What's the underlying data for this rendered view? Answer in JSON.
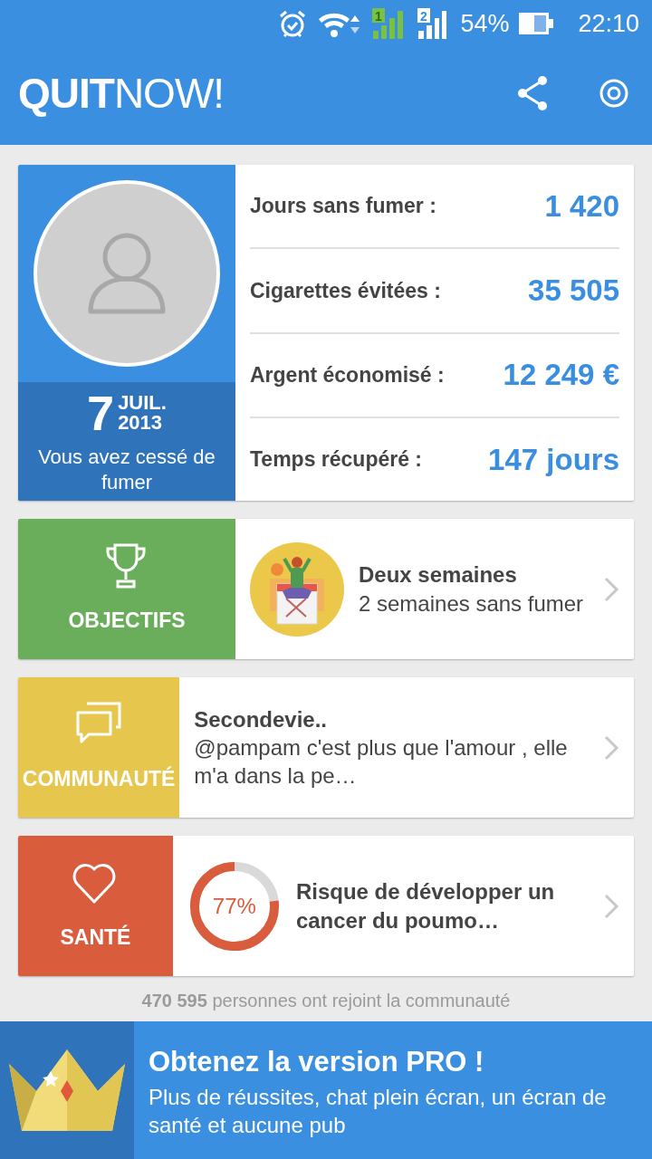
{
  "status_bar": {
    "battery": "54%",
    "time": "22:10",
    "sim_1": "1",
    "sim_2": "2"
  },
  "app_bar": {
    "logo_bold": "QUIT",
    "logo_light": "NOW!"
  },
  "profile": {
    "day": "7",
    "month": "JUIL.",
    "year": "2013",
    "caption": "Vous avez cessé de fumer"
  },
  "stats": [
    {
      "label": "Jours sans fumer :",
      "value": "1 420"
    },
    {
      "label": "Cigarettes évitées :",
      "value": "35 505"
    },
    {
      "label": "Argent économisé :",
      "value": "12 249 €"
    },
    {
      "label": "Temps récupéré :",
      "value": "147 jours"
    }
  ],
  "features": [
    {
      "kind": "goal",
      "tile_label": "OBJECTIFS",
      "color": "#6aae5c",
      "title": "Deux semaines",
      "text": "2 semaines sans fumer"
    },
    {
      "kind": "community",
      "tile_label": "COMMUNAUTÉ",
      "color": "#e7c64d",
      "title": "Secondevie..",
      "text": "@pampam c'est plus que l'amour , elle m'a dans la pe…"
    },
    {
      "kind": "health",
      "tile_label": "SANTÉ",
      "color": "#d95c3d",
      "percent": "77%",
      "level": 0.77,
      "title": "Risque de développer un cancer du poumo…"
    }
  ],
  "footer": "**470 595** personnes ont rejoint la communauté",
  "promo": {
    "title": "Obtenez la version PRO !",
    "text": "Plus de réussites, chat plein écran, un écran de santé et aucune pub"
  }
}
